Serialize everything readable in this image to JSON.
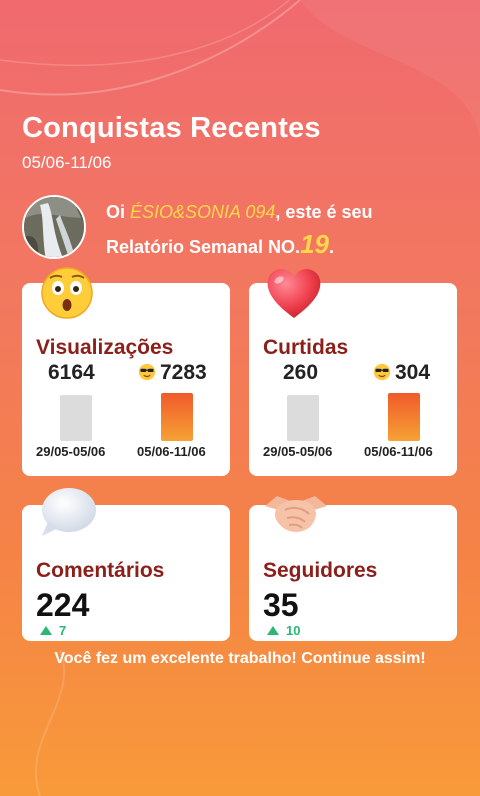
{
  "header": {
    "title": "Conquistas Recentes",
    "date_range": "05/06-11/06"
  },
  "greeting": {
    "prefix": "Oi ",
    "name": "ÉSIO&SONIA 094",
    "middle": ", este é seu",
    "line2": "Relatório Semanal NO.",
    "report_number": "19",
    "end": "."
  },
  "cards": {
    "views": {
      "icon": "surprised-face-icon",
      "title": "Visualizações",
      "prev_value": "6164",
      "cur_value": "7283",
      "prev_label": "29/05-05/06",
      "cur_label": "05/06-11/06"
    },
    "likes": {
      "icon": "heart-icon",
      "title": "Curtidas",
      "prev_value": "260",
      "cur_value": "304",
      "prev_label": "29/05-05/06",
      "cur_label": "05/06-11/06"
    },
    "comments": {
      "icon": "speech-bubble-icon",
      "title": "Comentários",
      "value": "224",
      "delta": "7"
    },
    "followers": {
      "icon": "handshake-icon",
      "title": "Seguidores",
      "value": "35",
      "delta": "10"
    }
  },
  "footer": {
    "message": "Você fez um excelente trabalho! Continue assim!"
  },
  "colors": {
    "accent_yellow": "#ffd84a",
    "card_title": "#8b1f1a",
    "delta_green": "#2bb673",
    "bar_gradient_top": "#f05a2a",
    "bar_gradient_bottom": "#f6a235"
  }
}
